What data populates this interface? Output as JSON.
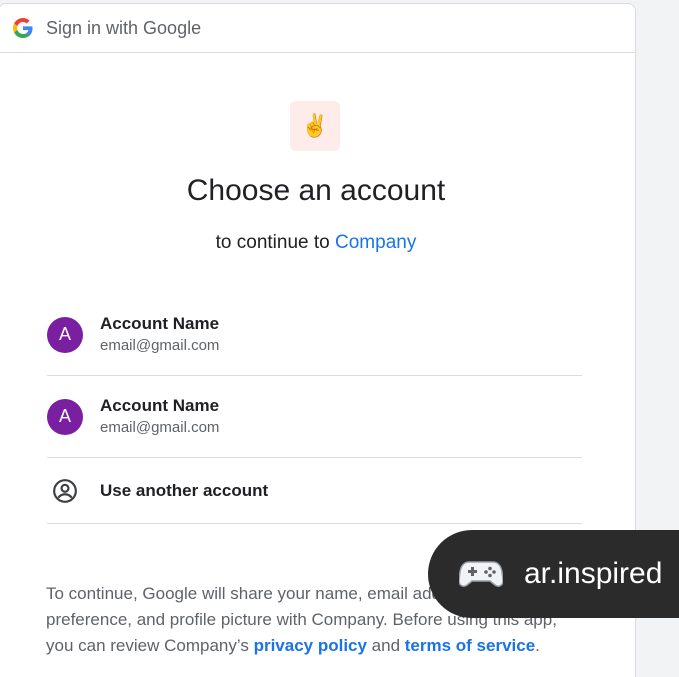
{
  "header": {
    "title": "Sign in with Google",
    "logo_icon": "google-g-icon"
  },
  "app_logo": {
    "emoji": "✌️",
    "background": "#fdecea"
  },
  "main": {
    "title": "Choose an account",
    "subtitle_prefix": "to continue to ",
    "subtitle_company": "Company"
  },
  "accounts": [
    {
      "initial": "A",
      "name": "Account Name",
      "email": "email@gmail.com"
    },
    {
      "initial": "A",
      "name": "Account Name",
      "email": "email@gmail.com"
    }
  ],
  "use_another": {
    "label": "Use another account",
    "icon": "account-circle-icon"
  },
  "disclaimer": {
    "text": "To continue, Google will share your name, email address, language preference, and profile picture with Company. Before using this app, you can review Company’s ",
    "privacy_link": "privacy policy",
    "and": " and ",
    "terms_link": "terms of service",
    "end": "."
  },
  "toast": {
    "icon": "game-controller-icon",
    "text": "ar.inspired"
  },
  "colors": {
    "accent": "#1a73e8",
    "avatar": "#7b1fa2",
    "toast_bg": "#2b2b2b"
  }
}
